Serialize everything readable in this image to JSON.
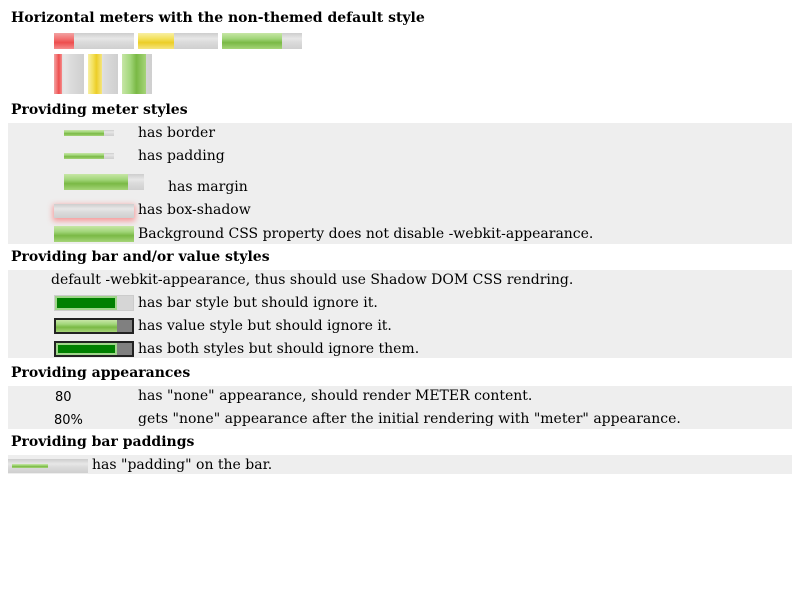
{
  "sections": {
    "horizontal_title": "Horizontal meters with the non-themed default style",
    "styles_title": "Providing meter styles",
    "bar_value_title": "Providing bar and/or value styles",
    "appearances_title": "Providing appearances",
    "bar_paddings_title": "Providing bar paddings"
  },
  "horizontal_meters": [
    {
      "level": 0.25,
      "color": "red"
    },
    {
      "level": 0.45,
      "color": "yellow"
    },
    {
      "level": 0.75,
      "color": "green"
    }
  ],
  "vertical_meters": [
    {
      "level": 0.3,
      "color": "red"
    },
    {
      "level": 0.5,
      "color": "yellow"
    },
    {
      "level": 0.8,
      "color": "green"
    }
  ],
  "styles": {
    "border_label": "has border",
    "padding_label": "has padding",
    "margin_label": "has margin",
    "box_shadow_label": "has box-shadow",
    "background_label": "Background CSS property does not disable -webkit-appearance.",
    "border_level": 0.8,
    "padding_level": 0.8,
    "margin_level": 0.8,
    "background_level": 1.0
  },
  "bar_value": {
    "default_label": "default -webkit-appearance, thus should use Shadow DOM CSS rendring.",
    "bar_label": "has bar style but should ignore it.",
    "value_label": "has value style but should ignore it.",
    "both_label": "has both styles but should ignore them.",
    "bar_level": 0.8,
    "value_level": 0.8,
    "both_level": 0.8
  },
  "appearances": {
    "none_value": "80",
    "none_label": "has \"none\" appearance, should render METER content.",
    "after_value": "80%",
    "after_label": "gets \"none\" appearance after the initial rendering with \"meter\" appearance."
  },
  "bar_paddings": {
    "label": "has \"padding\" on the bar.",
    "level": 0.5
  },
  "colors": {
    "band_background": "#eeeeee",
    "optimum_green": "#7ab945",
    "suboptimum_yellow": "#ecce27",
    "even_less_good_red": "#ee4e4e",
    "styled_bar_green": "#008000",
    "styled_value_gray": "#808080"
  }
}
